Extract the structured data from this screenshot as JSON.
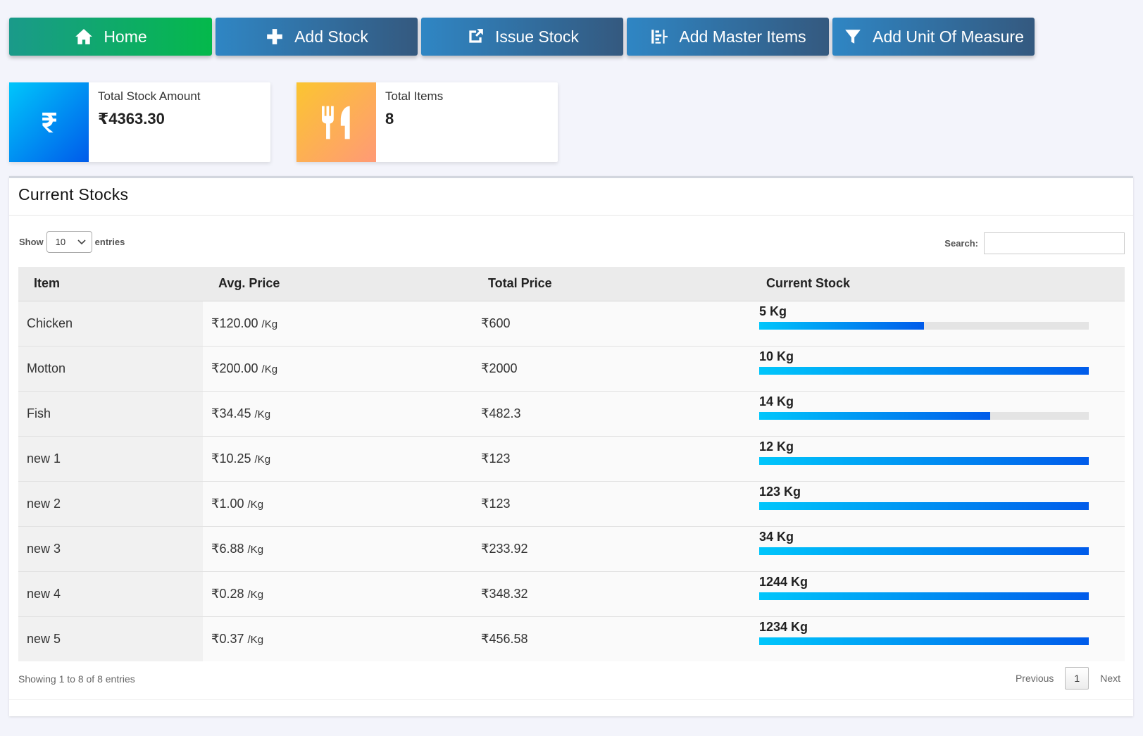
{
  "nav": {
    "buttons": [
      {
        "label": "Home",
        "icon": "home-icon"
      },
      {
        "label": "Add Stock",
        "icon": "plus-icon"
      },
      {
        "label": "Issue Stock",
        "icon": "share-icon"
      },
      {
        "label": "Add Master Items",
        "icon": "list-icon"
      },
      {
        "label": "Add Unit Of Measure",
        "icon": "filter-icon"
      }
    ]
  },
  "cards": {
    "amount": {
      "label": "Total Stock Amount",
      "value": "₹4363.30",
      "icon": "rupee-icon"
    },
    "items": {
      "label": "Total Items",
      "value": "8",
      "icon": "utensils-icon"
    }
  },
  "panel": {
    "title": "Current Stocks",
    "show_label": "Show",
    "entries_label": "entries",
    "page_length": "10",
    "search_label": "Search:",
    "search_value": ""
  },
  "table": {
    "headers": [
      "Item",
      "Avg. Price",
      "Total Price",
      "Current Stock"
    ],
    "rows": [
      {
        "item": "Chicken",
        "avg_price": "₹120.00",
        "unit": "/Kg",
        "total_price": "₹600",
        "stock": "5 Kg",
        "stock_fill": 0.5
      },
      {
        "item": "Motton",
        "avg_price": "₹200.00",
        "unit": "/Kg",
        "total_price": "₹2000",
        "stock": "10 Kg",
        "stock_fill": 1.0
      },
      {
        "item": "Fish",
        "avg_price": "₹34.45",
        "unit": "/Kg",
        "total_price": "₹482.3",
        "stock": "14 Kg",
        "stock_fill": 0.7
      },
      {
        "item": "new 1",
        "avg_price": "₹10.25",
        "unit": "/Kg",
        "total_price": "₹123",
        "stock": "12 Kg",
        "stock_fill": 1.0
      },
      {
        "item": "new 2",
        "avg_price": "₹1.00",
        "unit": "/Kg",
        "total_price": "₹123",
        "stock": "123 Kg",
        "stock_fill": 1.0
      },
      {
        "item": "new 3",
        "avg_price": "₹6.88",
        "unit": "/Kg",
        "total_price": "₹233.92",
        "stock": "34 Kg",
        "stock_fill": 1.0
      },
      {
        "item": "new 4",
        "avg_price": "₹0.28",
        "unit": "/Kg",
        "total_price": "₹348.32",
        "stock": "1244 Kg",
        "stock_fill": 1.0
      },
      {
        "item": "new 5",
        "avg_price": "₹0.37",
        "unit": "/Kg",
        "total_price": "₹456.58",
        "stock": "1234 Kg",
        "stock_fill": 1.0
      }
    ]
  },
  "footer": {
    "info": "Showing 1 to 8 of 8 entries",
    "previous": "Previous",
    "current_page": "1",
    "next": "Next"
  }
}
